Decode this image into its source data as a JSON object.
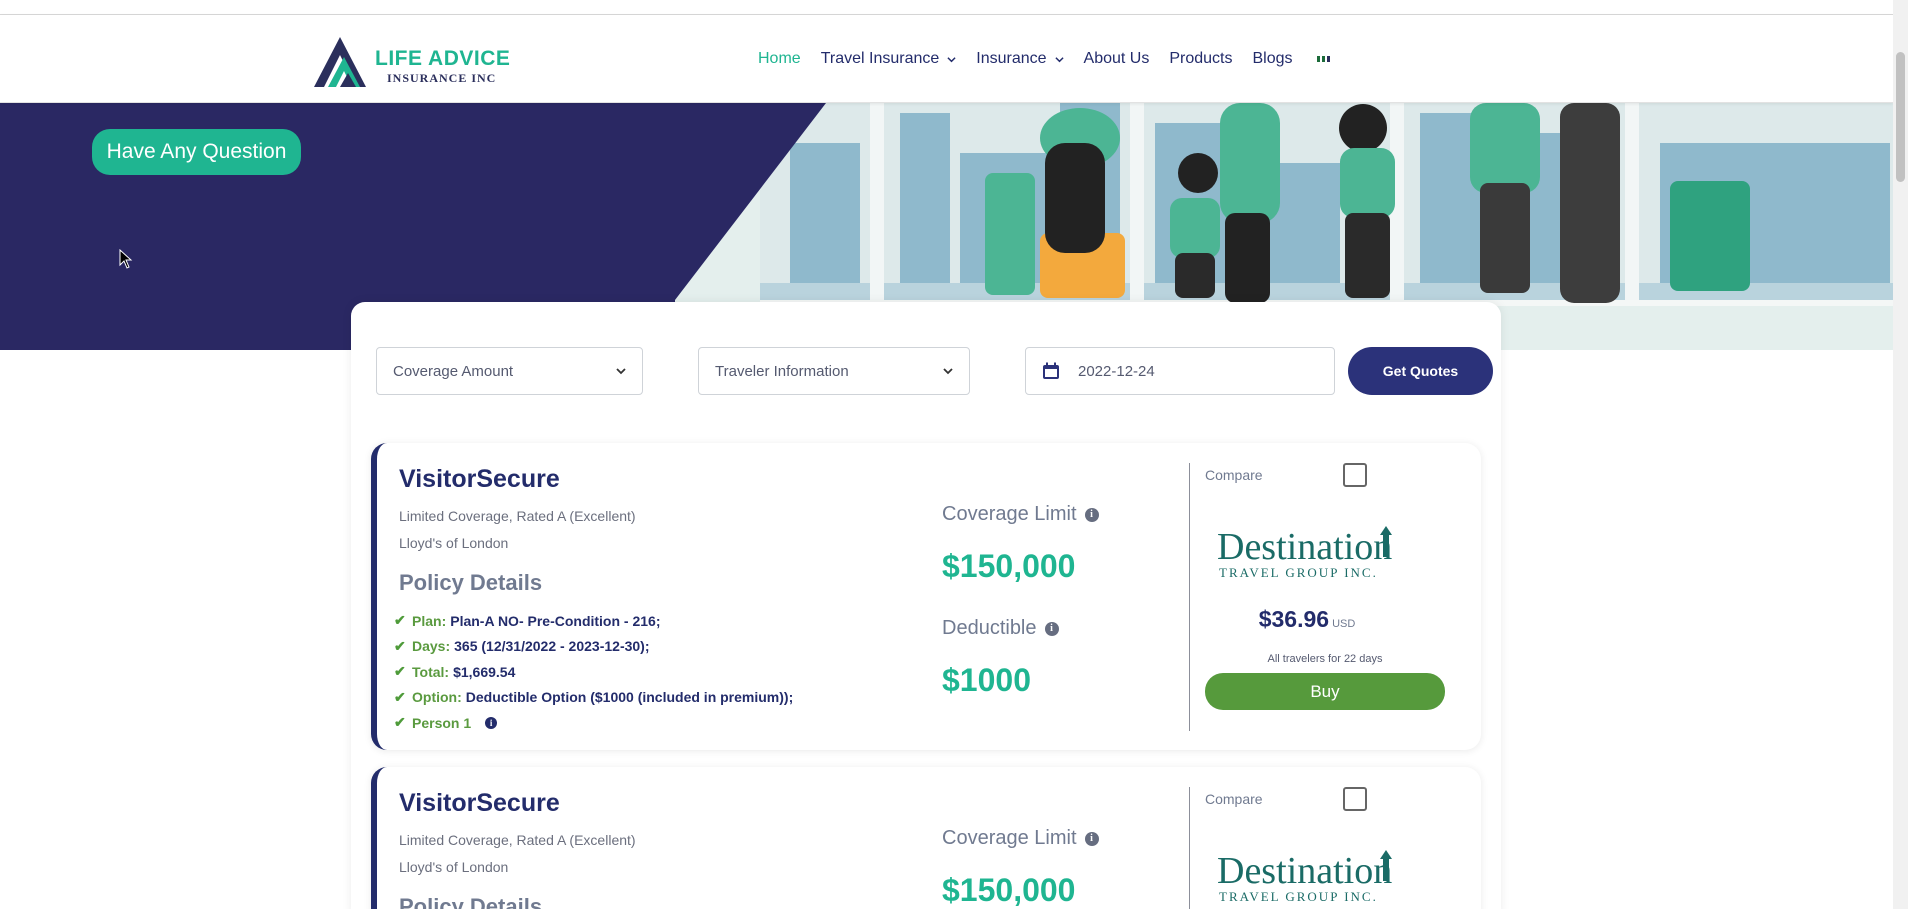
{
  "header": {
    "logo_line1": "LIFE ADVICE",
    "logo_line2": "INSURANCE INC",
    "nav": [
      {
        "label": "Home",
        "active": true
      },
      {
        "label": "Travel Insurance",
        "dropdown": true
      },
      {
        "label": "Insurance",
        "dropdown": true
      },
      {
        "label": "About Us"
      },
      {
        "label": "Products"
      },
      {
        "label": "Blogs"
      }
    ],
    "language_flag_icon": "flag-icon"
  },
  "hero": {
    "question_button": "Have Any Question"
  },
  "search": {
    "coverage_amount": "Coverage Amount",
    "traveler_information": "Traveler Information",
    "date": "2022-12-24",
    "get_quotes": "Get Quotes"
  },
  "results": [
    {
      "name": "VisitorSecure",
      "coverage_type": "Limited Coverage, Rated A (Excellent)",
      "underwriter": "Lloyd's of London",
      "policy_details_title": "Policy Details",
      "details": [
        {
          "key": "Plan:",
          "value": "Plan-A NO- Pre-Condition - 216;"
        },
        {
          "key": "Days:",
          "value": "365 (12/31/2022 - 2023-12-30);"
        },
        {
          "key": "Total:",
          "value": "$1,669.54"
        },
        {
          "key": "Option:",
          "value": "Deductible Option ($1000 (included in premium));"
        },
        {
          "key": "Person 1",
          "value": ""
        }
      ],
      "coverage_limit_label": "Coverage Limit",
      "coverage_limit": "$150,000",
      "deductible_label": "Deductible",
      "deductible": "$1000",
      "compare_label": "Compare",
      "provider_line1": "Destination",
      "provider_line2": "TRAVEL GROUP INC.",
      "price": "$36.96",
      "currency": "USD",
      "travelers_note": "All travelers for 22 days",
      "buy_label": "Buy"
    },
    {
      "name": "VisitorSecure",
      "coverage_type": "Limited Coverage, Rated A (Excellent)",
      "underwriter": "Lloyd's of London",
      "policy_details_title": "Policy Details",
      "coverage_limit_label": "Coverage Limit",
      "coverage_limit": "$150,000",
      "compare_label": "Compare",
      "provider_line1": "Destination",
      "provider_line2": "TRAVEL GROUP INC."
    }
  ],
  "colors": {
    "brand_green": "#1fb591",
    "brand_navy": "#232c6b",
    "hero_navy": "#2a2863",
    "buy_green": "#569a3c"
  }
}
